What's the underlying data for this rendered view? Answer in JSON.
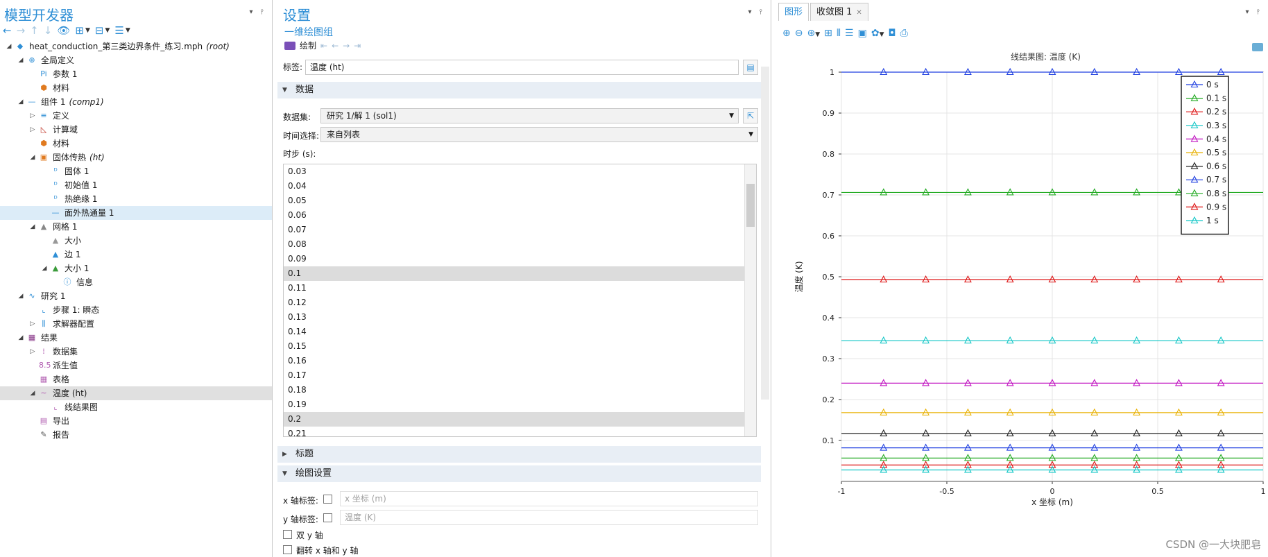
{
  "model_builder": {
    "title": "模型开发器",
    "tree": [
      {
        "label": "heat_conduction_第三类边界条件_练习.mph",
        "suffix": "(root)",
        "level": 0,
        "toggle": "down",
        "icon": "model-icon",
        "icon_char": "◆",
        "icon_color": "#2f8fd6",
        "sel": ""
      },
      {
        "label": "全局定义",
        "suffix": "",
        "level": 1,
        "toggle": "down",
        "icon": "globe-icon",
        "icon_char": "⊕",
        "icon_color": "#2f8fd6",
        "sel": ""
      },
      {
        "label": "参数 1",
        "suffix": "",
        "level": 2,
        "toggle": "",
        "icon": "parameter-icon",
        "icon_char": "Pi",
        "icon_color": "#2f8fd6",
        "sel": ""
      },
      {
        "label": "材料",
        "suffix": "",
        "level": 2,
        "toggle": "",
        "icon": "materials-icon",
        "icon_char": "⬢",
        "icon_color": "#e07a1f",
        "sel": ""
      },
      {
        "label": "组件 1",
        "suffix": "(comp1)",
        "level": 1,
        "toggle": "down",
        "icon": "component-icon",
        "icon_char": "—",
        "icon_color": "#2f8fd6",
        "sel": ""
      },
      {
        "label": "定义",
        "suffix": "",
        "level": 2,
        "toggle": "right",
        "icon": "definitions-icon",
        "icon_char": "≡",
        "icon_color": "#2f8fd6",
        "sel": ""
      },
      {
        "label": "计算域",
        "suffix": "",
        "level": 2,
        "toggle": "right",
        "icon": "geometry-icon",
        "icon_char": "◺",
        "icon_color": "#c0392b",
        "sel": ""
      },
      {
        "label": "材料",
        "suffix": "",
        "level": 2,
        "toggle": "",
        "icon": "materials-icon",
        "icon_char": "⬢",
        "icon_color": "#e07a1f",
        "sel": ""
      },
      {
        "label": "固体传热",
        "suffix": "(ht)",
        "level": 2,
        "toggle": "down",
        "icon": "heat-transfer-icon",
        "icon_char": "▣",
        "icon_color": "#e07a1f",
        "sel": ""
      },
      {
        "label": "固体 1",
        "suffix": "",
        "level": 3,
        "toggle": "",
        "icon": "domain-node-icon",
        "icon_char": "ᴰ",
        "icon_color": "#2f8fd6",
        "sel": ""
      },
      {
        "label": "初始值 1",
        "suffix": "",
        "level": 3,
        "toggle": "",
        "icon": "domain-node-icon",
        "icon_char": "ᴰ",
        "icon_color": "#2f8fd6",
        "sel": ""
      },
      {
        "label": "热绝缘 1",
        "suffix": "",
        "level": 3,
        "toggle": "",
        "icon": "boundary-node-icon",
        "icon_char": "ᴰ",
        "icon_color": "#2f8fd6",
        "sel": ""
      },
      {
        "label": "面外热通量 1",
        "suffix": "",
        "level": 3,
        "toggle": "",
        "icon": "edge-node-icon",
        "icon_char": "—",
        "icon_color": "#2f8fd6",
        "sel": "sel"
      },
      {
        "label": "网格 1",
        "suffix": "",
        "level": 2,
        "toggle": "down",
        "icon": "mesh-icon",
        "icon_char": "▲",
        "icon_color": "#888888",
        "sel": ""
      },
      {
        "label": "大小",
        "suffix": "",
        "level": 3,
        "toggle": "",
        "icon": "mesh-size-icon",
        "icon_char": "▲",
        "icon_color": "#999999",
        "sel": ""
      },
      {
        "label": "边 1",
        "suffix": "",
        "level": 3,
        "toggle": "",
        "icon": "mesh-edge-icon",
        "icon_char": "▲",
        "icon_color": "#2f8fd6",
        "sel": ""
      },
      {
        "label": "大小 1",
        "suffix": "",
        "level": 3,
        "toggle": "down",
        "icon": "mesh-size-icon",
        "icon_char": "▲",
        "icon_color": "#3a9b3a",
        "sel": ""
      },
      {
        "label": "信息",
        "suffix": "",
        "level": 4,
        "toggle": "",
        "icon": "info-icon",
        "icon_char": "ⓘ",
        "icon_color": "#2f8fd6",
        "sel": ""
      },
      {
        "label": "研究 1",
        "suffix": "",
        "level": 1,
        "toggle": "down",
        "icon": "study-icon",
        "icon_char": "∿",
        "icon_color": "#2f8fd6",
        "sel": ""
      },
      {
        "label": "步骤 1: 瞬态",
        "suffix": "",
        "level": 2,
        "toggle": "",
        "icon": "step-icon",
        "icon_char": "⌞",
        "icon_color": "#2f8fd6",
        "sel": ""
      },
      {
        "label": "求解器配置",
        "suffix": "",
        "level": 2,
        "toggle": "right",
        "icon": "solver-icon",
        "icon_char": "⫼",
        "icon_color": "#2f8fd6",
        "sel": ""
      },
      {
        "label": "结果",
        "suffix": "",
        "level": 1,
        "toggle": "down",
        "icon": "results-icon",
        "icon_char": "▦",
        "icon_color": "#8a3a8a",
        "sel": ""
      },
      {
        "label": "数据集",
        "suffix": "",
        "level": 2,
        "toggle": "right",
        "icon": "datasets-icon",
        "icon_char": "⁞",
        "icon_color": "#b25fb2",
        "sel": ""
      },
      {
        "label": "派生值",
        "suffix": "",
        "level": 2,
        "toggle": "",
        "icon": "derived-values-icon",
        "icon_char": "8.5",
        "icon_color": "#b25fb2",
        "sel": ""
      },
      {
        "label": "表格",
        "suffix": "",
        "level": 2,
        "toggle": "",
        "icon": "tables-icon",
        "icon_char": "▦",
        "icon_color": "#b25fb2",
        "sel": ""
      },
      {
        "label": "温度 (ht)",
        "suffix": "",
        "level": 2,
        "toggle": "down",
        "icon": "plot-group-1d-icon",
        "icon_char": "∼",
        "icon_color": "#b25fb2",
        "sel": "sel2"
      },
      {
        "label": "线结果图",
        "suffix": "",
        "level": 3,
        "toggle": "",
        "icon": "line-graph-icon",
        "icon_char": "⌞",
        "icon_color": "#b25fb2",
        "sel": ""
      },
      {
        "label": "导出",
        "suffix": "",
        "level": 2,
        "toggle": "",
        "icon": "export-icon",
        "icon_char": "▤",
        "icon_color": "#b25fb2",
        "sel": ""
      },
      {
        "label": "报告",
        "suffix": "",
        "level": 2,
        "toggle": "",
        "icon": "report-icon",
        "icon_char": "✎",
        "icon_color": "#555555",
        "sel": ""
      }
    ]
  },
  "settings": {
    "title": "设置",
    "subtitle": "一维绘图组",
    "plot_label": "绘制",
    "label_name": "标签:",
    "label_value": "温度 (ht)",
    "section_data": "数据",
    "dataset_label": "数据集:",
    "dataset_value": "研究 1/解 1 (sol1)",
    "time_select_label": "时间选择:",
    "time_select_value": "来自列表",
    "time_steps_label": "时步 (s):",
    "time_steps": [
      {
        "v": "0.03",
        "s": ""
      },
      {
        "v": "0.04",
        "s": ""
      },
      {
        "v": "0.05",
        "s": ""
      },
      {
        "v": "0.06",
        "s": ""
      },
      {
        "v": "0.07",
        "s": ""
      },
      {
        "v": "0.08",
        "s": ""
      },
      {
        "v": "0.09",
        "s": ""
      },
      {
        "v": "0.1",
        "s": "sel"
      },
      {
        "v": "0.11",
        "s": ""
      },
      {
        "v": "0.12",
        "s": ""
      },
      {
        "v": "0.13",
        "s": ""
      },
      {
        "v": "0.14",
        "s": ""
      },
      {
        "v": "0.15",
        "s": ""
      },
      {
        "v": "0.16",
        "s": ""
      },
      {
        "v": "0.17",
        "s": ""
      },
      {
        "v": "0.18",
        "s": ""
      },
      {
        "v": "0.19",
        "s": ""
      },
      {
        "v": "0.2",
        "s": "sel"
      },
      {
        "v": "0.21",
        "s": ""
      }
    ],
    "section_title": "标题",
    "section_plot_settings": "绘图设置",
    "x_axis_label": "x 轴标签:",
    "x_axis_placeholder": "x 坐标 (m)",
    "y_axis_label": "y 轴标签:",
    "y_axis_placeholder": "温度 (K)",
    "dual_y": "双 y 轴",
    "flip_xy": "翻转 x 轴和 y 轴"
  },
  "graphics": {
    "tab_graphics": "图形",
    "tab_convergence": "收敛图 1",
    "watermark": "CSDN @一大块肥皂"
  },
  "chart_data": {
    "type": "line",
    "title": "线结果图: 温度 (K)",
    "xlabel": "x 坐标 (m)",
    "ylabel": "温度 (K)",
    "xlim": [
      -1,
      1
    ],
    "ylim": [
      0,
      1
    ],
    "x_ticks": [
      -1,
      -0.5,
      0,
      0.5,
      1
    ],
    "y_ticks": [
      0.1,
      0.2,
      0.3,
      0.4,
      0.5,
      0.6,
      0.7,
      0.8,
      0.9,
      1
    ],
    "x_tick_labels": [
      "-1",
      "-0.5",
      "0",
      "0.5",
      "1"
    ],
    "y_tick_labels": [
      "0.1",
      "0.2",
      "0.3",
      "0.4",
      "0.5",
      "0.6",
      "0.7",
      "0.8",
      "0.9",
      "1"
    ],
    "grid": true,
    "legend_position": "top-right",
    "marker_x": [
      -0.8,
      -0.6,
      -0.4,
      -0.2,
      0,
      0.2,
      0.4,
      0.6,
      0.8
    ],
    "series": [
      {
        "name": "0 s",
        "value": 1.0,
        "color": "#1f3fe0"
      },
      {
        "name": "0.1 s",
        "value": 0.706,
        "color": "#22aa22"
      },
      {
        "name": "0.2 s",
        "value": 0.493,
        "color": "#dd1111"
      },
      {
        "name": "0.3 s",
        "value": 0.344,
        "color": "#11c6c6"
      },
      {
        "name": "0.4 s",
        "value": 0.24,
        "color": "#c011c0"
      },
      {
        "name": "0.5 s",
        "value": 0.168,
        "color": "#e8b000"
      },
      {
        "name": "0.6 s",
        "value": 0.117,
        "color": "#222222"
      },
      {
        "name": "0.7 s",
        "value": 0.082,
        "color": "#1f3fe0"
      },
      {
        "name": "0.8 s",
        "value": 0.057,
        "color": "#22aa22"
      },
      {
        "name": "0.9 s",
        "value": 0.04,
        "color": "#dd1111"
      },
      {
        "name": "1 s",
        "value": 0.028,
        "color": "#11c6c6"
      }
    ]
  }
}
